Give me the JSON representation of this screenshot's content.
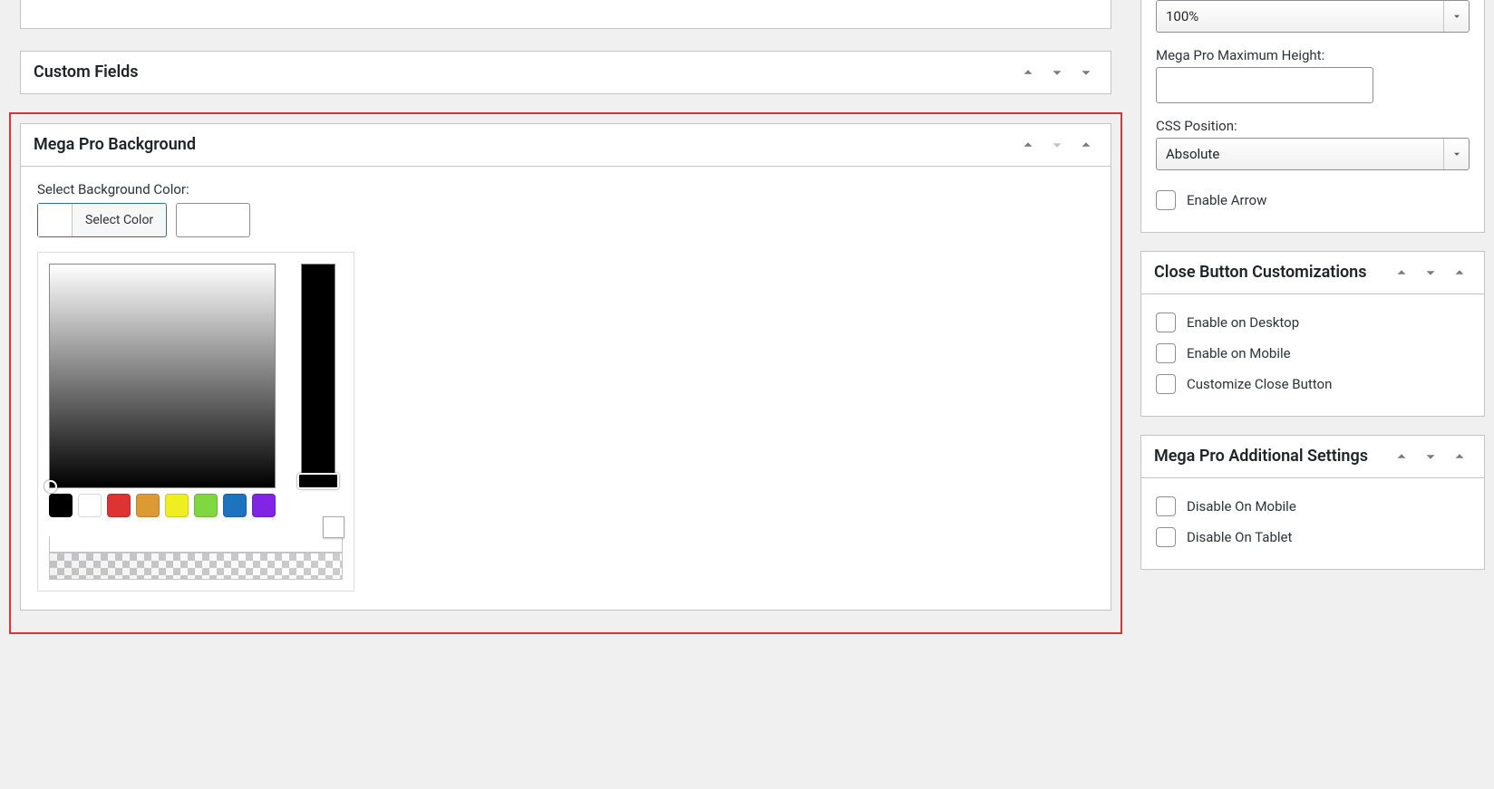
{
  "main": {
    "customFields": {
      "title": "Custom Fields"
    },
    "megaProBg": {
      "title": "Mega Pro Background",
      "label": "Select Background Color:",
      "button": "Select Color",
      "palette": [
        "#000000",
        "#ffffff",
        "#dd3333",
        "#dd9933",
        "#eeee22",
        "#81d742",
        "#1e73be",
        "#8224e3"
      ]
    }
  },
  "sidebar": {
    "topPanel": {
      "widthValue": "100%",
      "maxHeightLabel": "Mega Pro Maximum Height:",
      "maxHeightValue": "",
      "cssPosLabel": "CSS Position:",
      "cssPosValue": "Absolute",
      "enableArrow": "Enable Arrow"
    },
    "closeBtn": {
      "title": "Close Button Customizations",
      "enableDesktop": "Enable on Desktop",
      "enableMobile": "Enable on Mobile",
      "customize": "Customize Close Button"
    },
    "additional": {
      "title": "Mega Pro Additional Settings",
      "disableMobile": "Disable On Mobile",
      "disableTablet": "Disable On Tablet"
    }
  }
}
